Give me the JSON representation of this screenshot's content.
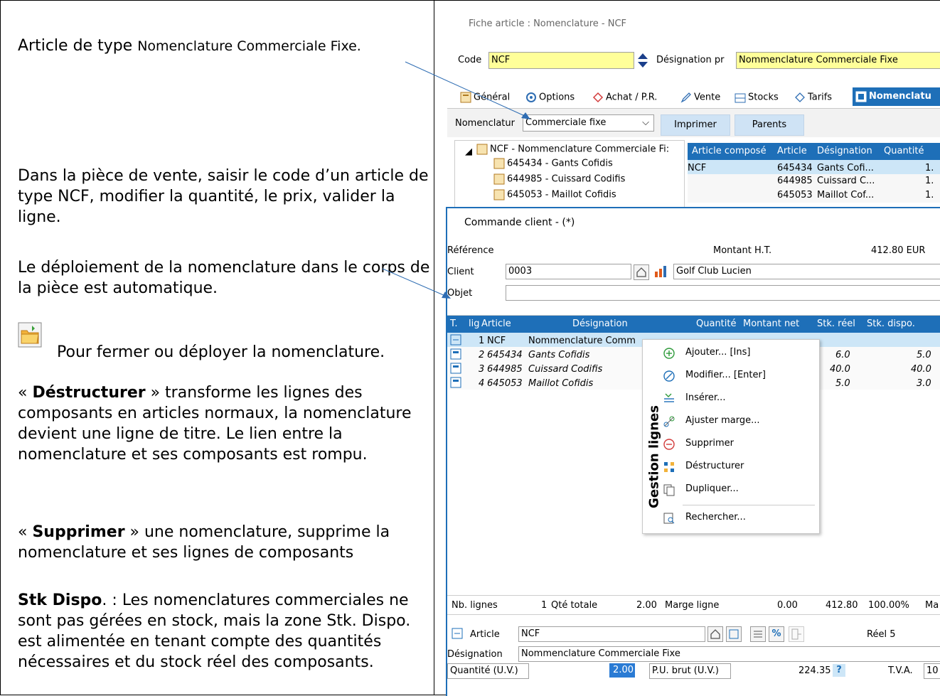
{
  "left": {
    "p1_a": "Article de type ",
    "p1_b": "Nomenclature Commerciale Fixe.",
    "p2": "Dans la pièce de vente, saisir le code d’un article de type NCF, modifier la quantité, le prix, valider la ligne.",
    "p3": "Le déploiement de la nomenclature dans le corps de la pièce est automatique.",
    "p4": "Pour fermer ou déployer la nomenclature.",
    "p5_open": "« ",
    "p5_bold": "Déstructurer",
    "p5_rest": " »  transforme les lignes des composants en articles normaux, la nomenclature devient une ligne de titre. Le lien entre la nomenclature et ses composants est rompu.",
    "p6_open": "« ",
    "p6_bold": "Supprimer",
    "p6_rest": " » une nomenclature, supprime la nomenclature et ses lignes de composants",
    "p7_bold": "Stk Dispo",
    "p7_rest": ". : Les nomenclatures commerciales ne sont pas gérées en stock, mais la zone Stk. Dispo. est alimentée en tenant compte des quantités nécessaires et du stock réel des composants."
  },
  "fiche": {
    "title": "Fiche article : Nomenclature - NCF",
    "code_label": "Code",
    "code_value": "NCF",
    "designation_label": "Désignation pr",
    "designation_value": "Nommenclature Commerciale Fixe",
    "tabs": [
      "Général",
      "Options",
      "Achat / P.R.",
      "Vente",
      "Stocks",
      "Tarifs",
      "Nomenclatu"
    ],
    "nomenclature_label": "Nomenclatur",
    "nomenclature_value": "Commerciale fixe",
    "print_button": "Imprimer",
    "parents_button": "Parents",
    "tree_root": "NCF - Nommenclature Commerciale Fi:",
    "tree_children": [
      "645434 - Gants Cofidis",
      "644985 - Cuissard Codifis",
      "645053 - Maillot Cofidis"
    ],
    "table_headers": [
      "Article composé",
      "Article",
      "Désignation",
      "Quantité"
    ],
    "table_rows": [
      [
        "NCF",
        "645434",
        "Gants Cofi...",
        "1."
      ],
      [
        "",
        "644985",
        "Cuissard C...",
        "1."
      ],
      [
        "",
        "645053",
        "Maillot Cof...",
        "1."
      ]
    ]
  },
  "commande": {
    "title": "Commande client -  (*)",
    "reference_label": "Référence",
    "montant_label": "Montant H.T.",
    "montant_value": "412.80 EUR",
    "client_label": "Client",
    "client_code": "0003",
    "client_name": "Golf Club Lucien",
    "objet_label": "Objet",
    "grid_headers": [
      "T.",
      "lig",
      "Article",
      "Désignation",
      "Quantité",
      "Montant net",
      "Stk. réel",
      "Stk. dispo."
    ],
    "grid_rows": [
      {
        "ligne": "1",
        "article": "NCF",
        "designation": "Nommenclature Comm",
        "stk_reel": "",
        "stk_dispo": ""
      },
      {
        "ligne": "2",
        "article": "645434",
        "designation": "Gants Cofidis",
        "stk_reel": "6.0",
        "stk_dispo": "5.0"
      },
      {
        "ligne": "3",
        "article": "644985",
        "designation": "Cuissard Codifis",
        "stk_reel": "40.0",
        "stk_dispo": "40.0"
      },
      {
        "ligne": "4",
        "article": "645053",
        "designation": "Maillot Cofidis",
        "stk_reel": "5.0",
        "stk_dispo": "3.0"
      }
    ],
    "context_menu": {
      "side_label": "Gestion lignes",
      "items": [
        "Ajouter... [Ins]",
        "Modifier... [Enter]",
        "Insérer...",
        "Ajuster marge...",
        "Supprimer",
        "Déstructurer",
        "Dupliquer...",
        "Rechercher..."
      ]
    },
    "footer": {
      "nb_lignes_label": "Nb. lignes",
      "nb_lignes_value": "1",
      "qte_totale_label": "Qté totale",
      "qte_totale_value": "2.00",
      "marge_ligne_label": "Marge ligne",
      "marge_ligne_value": "0.00",
      "montant_value": "412.80",
      "pct_value": "100.00%",
      "ma_label": "Ma"
    },
    "detail": {
      "article_label": "Article",
      "article_value": "NCF",
      "reel_label": "Réel 5",
      "designation_label": "Désignation",
      "designation_value": "Nommenclature Commerciale Fixe",
      "quantite_label": "Quantité (U.V.)",
      "quantite_value": "2.00",
      "pu_label": "P.U. brut (U.V.)",
      "pu_value": "224.35",
      "help": "?",
      "tva_label": "T.V.A.",
      "tva_value": "10"
    }
  },
  "colors": {
    "accent": "#1e6fb8",
    "highlight": "#cde6f7",
    "yellow": "#ffff99",
    "tab_active": "#1e6fb8"
  }
}
